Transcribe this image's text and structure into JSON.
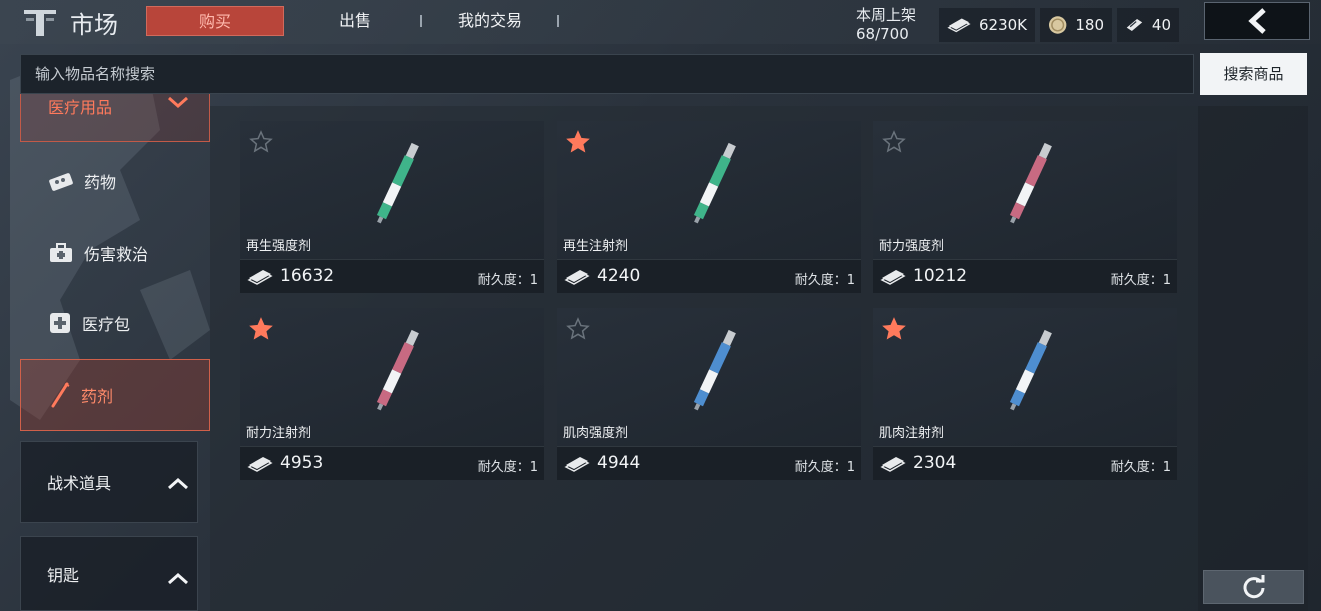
{
  "header": {
    "app_title": "市场",
    "tabs": [
      {
        "label": "购买",
        "active": true
      },
      {
        "label": "出售",
        "active": false
      },
      {
        "label": "我的交易",
        "active": false
      }
    ],
    "weekly_label": "本周上架",
    "weekly_value": "68/700",
    "currencies": [
      {
        "icon": "cash-icon",
        "value": "6230K"
      },
      {
        "icon": "coin-icon",
        "value": "180"
      },
      {
        "icon": "ticket-icon",
        "value": "40"
      }
    ]
  },
  "search": {
    "placeholder": "输入物品名称搜索",
    "button_label": "搜索商品"
  },
  "sidebar": {
    "category": {
      "label": "医疗用品",
      "expanded": true
    },
    "items": [
      {
        "label": "药物",
        "icon": "pills-icon",
        "active": false
      },
      {
        "label": "伤害救治",
        "icon": "first-aid-kit-icon",
        "active": false
      },
      {
        "label": "医疗包",
        "icon": "medkit-icon",
        "active": false
      },
      {
        "label": "药剂",
        "icon": "syringe-icon",
        "active": true
      }
    ],
    "groups": [
      {
        "label": "战术道具",
        "collapsed": true
      },
      {
        "label": "钥匙",
        "collapsed": true
      }
    ]
  },
  "products": [
    {
      "name": "再生强度剂",
      "price": "16632",
      "durability": "耐久度：1",
      "favorited": false,
      "color": "#3fb48a"
    },
    {
      "name": "再生注射剂",
      "price": "4240",
      "durability": "耐久度：1",
      "favorited": true,
      "color": "#3fb48a"
    },
    {
      "name": "耐力强度剂",
      "price": "10212",
      "durability": "耐久度：1",
      "favorited": false,
      "color": "#c86a82"
    },
    {
      "name": "耐力注射剂",
      "price": "4953",
      "durability": "耐久度：1",
      "favorited": true,
      "color": "#c86a82"
    },
    {
      "name": "肌肉强度剂",
      "price": "4944",
      "durability": "耐久度：1",
      "favorited": false,
      "color": "#4e8ed0"
    },
    {
      "name": "肌肉注射剂",
      "price": "2304",
      "durability": "耐久度：1",
      "favorited": true,
      "color": "#4e8ed0"
    }
  ],
  "colors": {
    "accent": "#ff7a5c",
    "star_active": "#ff7a5c",
    "star_inactive": "#6a737c"
  }
}
